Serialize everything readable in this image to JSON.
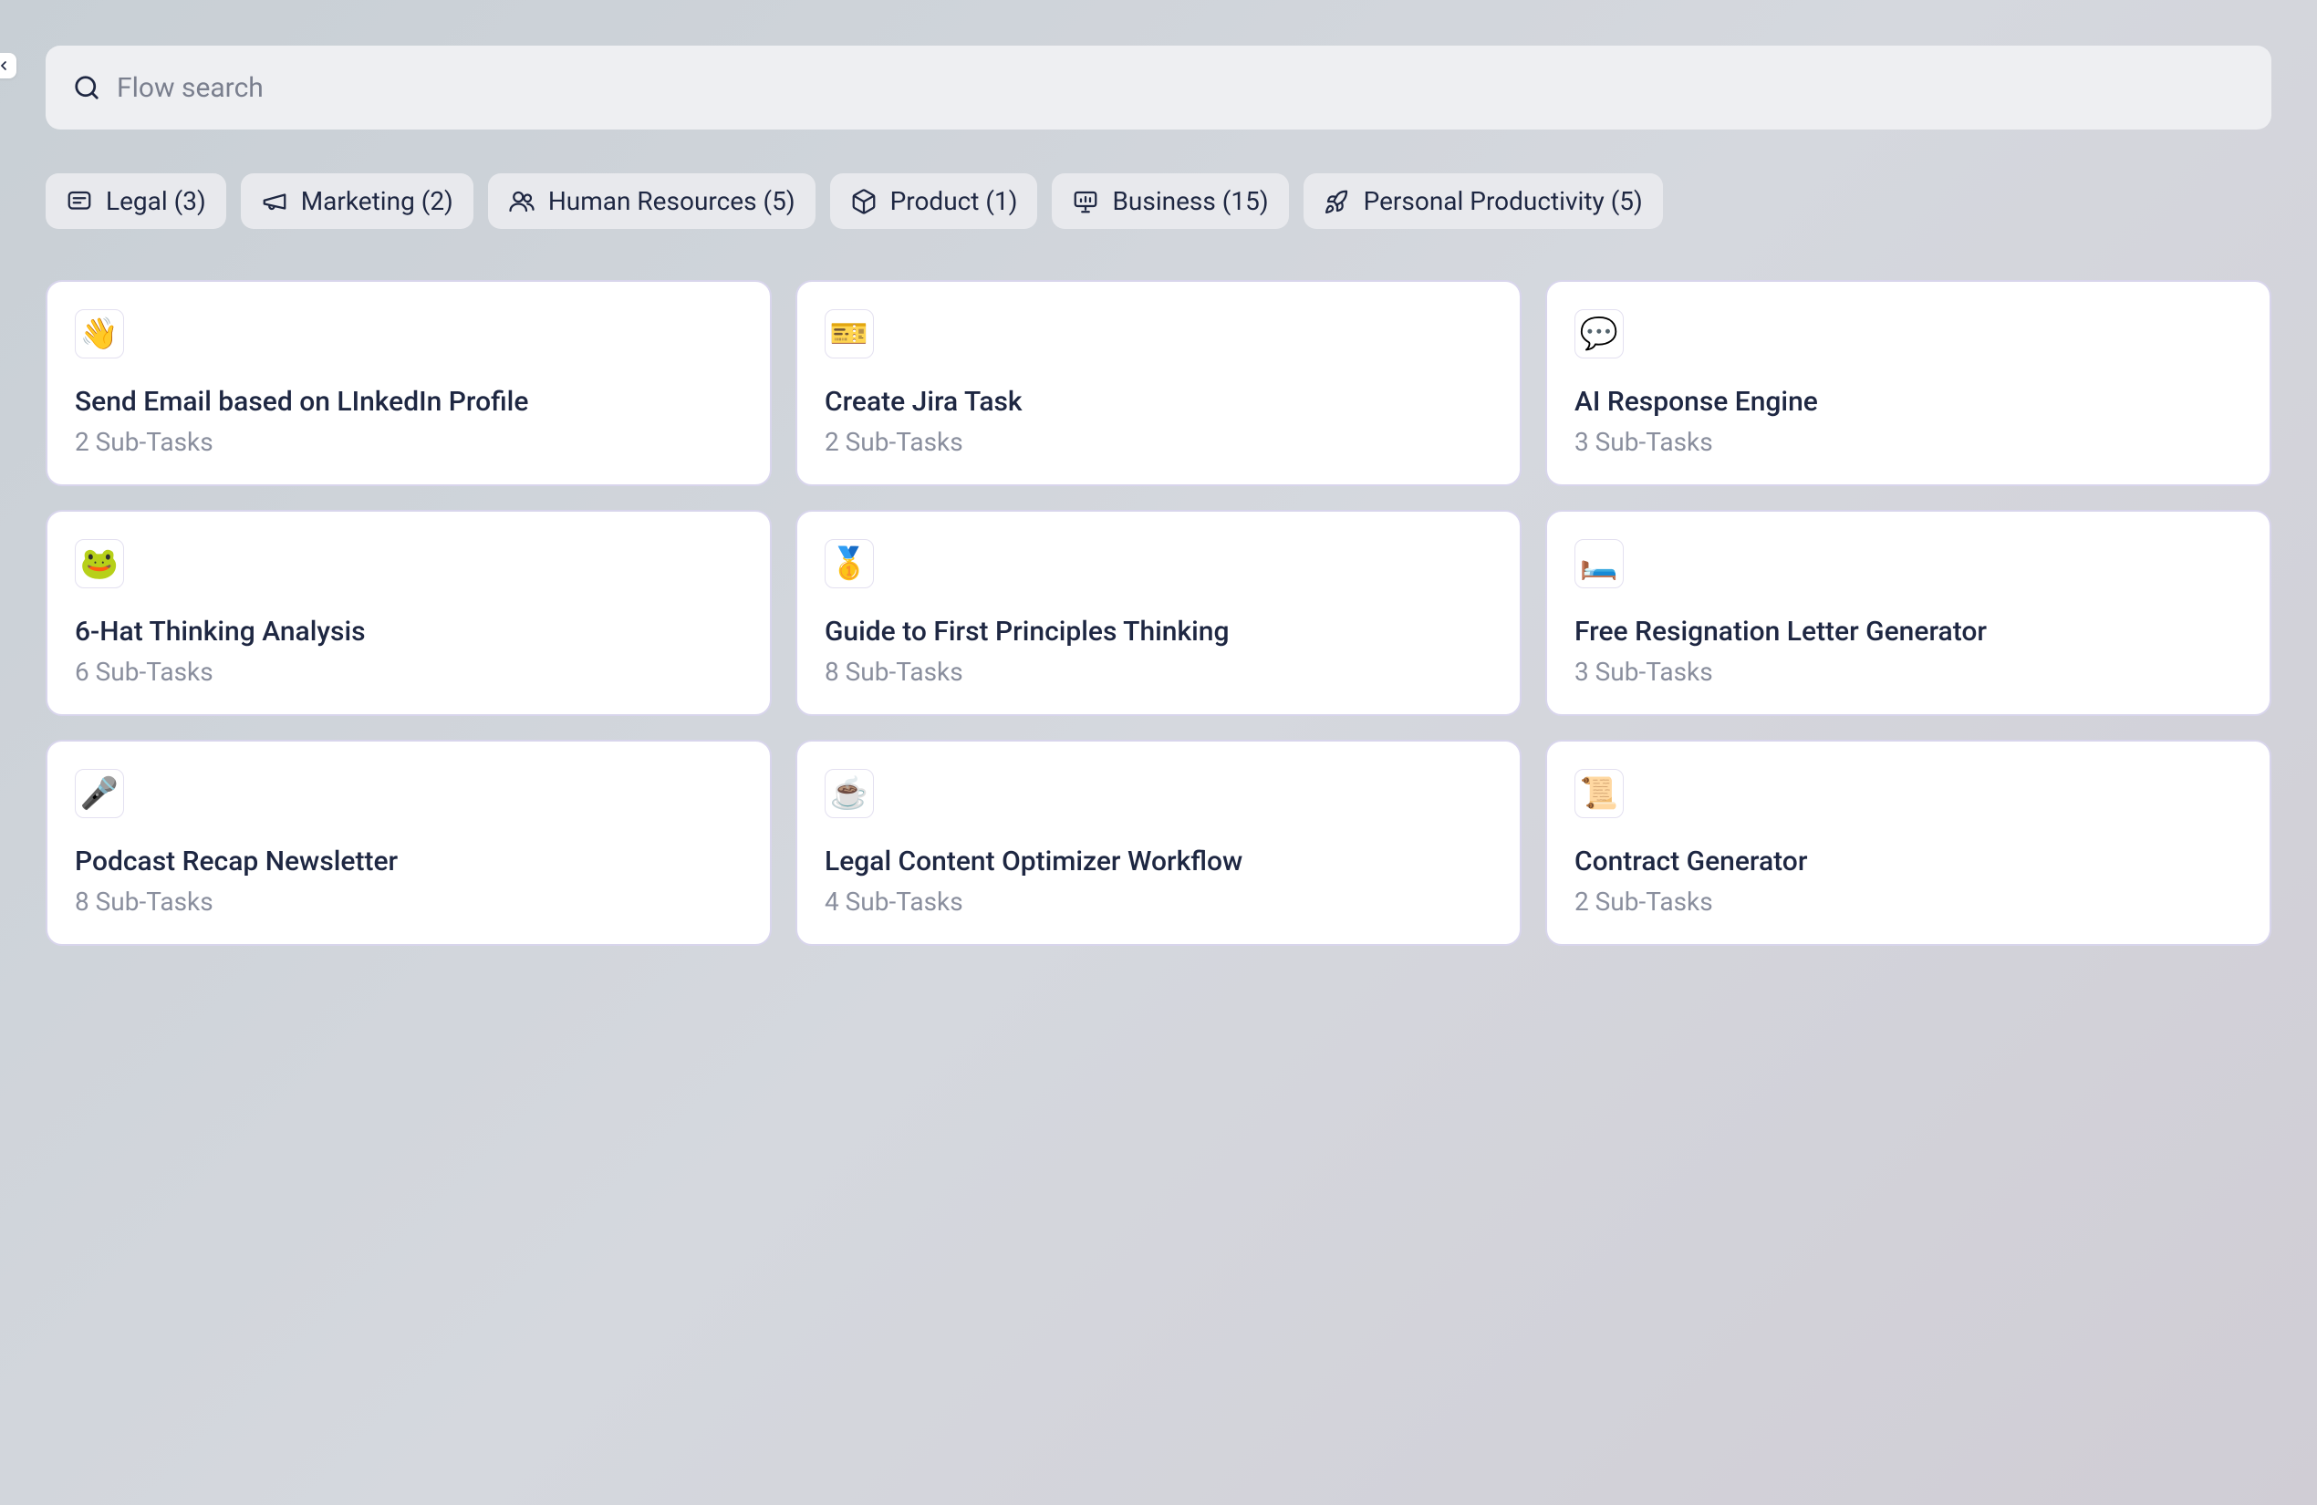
{
  "search": {
    "placeholder": "Flow search",
    "value": ""
  },
  "filters": [
    {
      "label": "Legal (3)",
      "icon": "message"
    },
    {
      "label": "Marketing (2)",
      "icon": "megaphone"
    },
    {
      "label": "Human Resources (5)",
      "icon": "users"
    },
    {
      "label": "Product (1)",
      "icon": "package"
    },
    {
      "label": "Business (15)",
      "icon": "presentation"
    },
    {
      "label": "Personal Productivity (5)",
      "icon": "rocket"
    }
  ],
  "cards": [
    {
      "emoji": "👋",
      "title": "Send Email based on LInkedIn Profile",
      "subtitle": "2 Sub-Tasks"
    },
    {
      "emoji": "🎫",
      "title": "Create Jira Task",
      "subtitle": "2 Sub-Tasks"
    },
    {
      "emoji": "💬",
      "title": "AI Response Engine",
      "subtitle": "3 Sub-Tasks"
    },
    {
      "emoji": "🐸",
      "title": "6-Hat Thinking Analysis",
      "subtitle": "6 Sub-Tasks"
    },
    {
      "emoji": "🥇",
      "title": "Guide to First Principles Thinking",
      "subtitle": "8 Sub-Tasks"
    },
    {
      "emoji": "🛏️",
      "title": "Free Resignation Letter Generator",
      "subtitle": "3 Sub-Tasks"
    },
    {
      "emoji": "🎤",
      "title": "Podcast Recap Newsletter",
      "subtitle": "8 Sub-Tasks"
    },
    {
      "emoji": "☕",
      "title": "Legal Content Optimizer Workflow",
      "subtitle": "4 Sub-Tasks"
    },
    {
      "emoji": "📜",
      "title": "Contract Generator",
      "subtitle": "2 Sub-Tasks"
    }
  ]
}
